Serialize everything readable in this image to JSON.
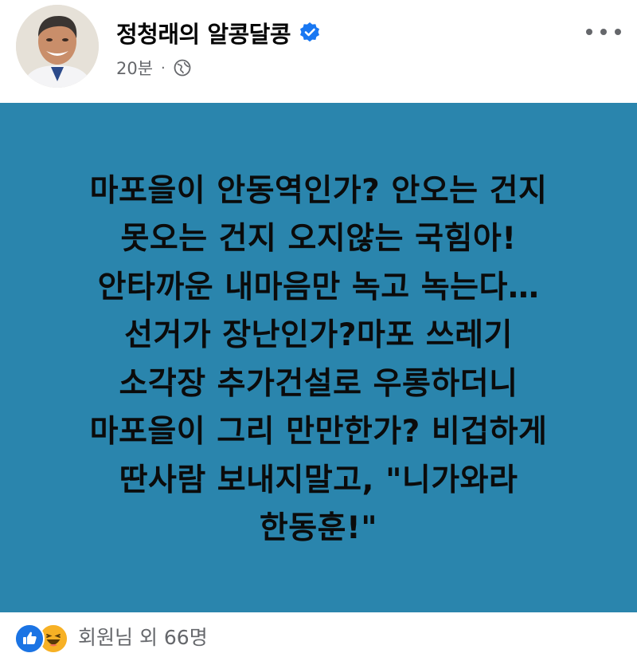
{
  "post": {
    "author": "정청래의 알콩달콩",
    "time": "20분",
    "separator": "·",
    "body_lines": [
      "마포을이 안동역인가? 안오는 건지",
      "못오는 건지 오지않는 국힘아!",
      "안타까운 내마음만 녹고 녹는다…",
      "선거가 장난인가?마포 쓰레기",
      "소각장 추가건설로 우롱하더니",
      "마포을이 그리 만만한가? 비겁하게",
      "딴사람 보내지말고, \"니가와라",
      "한동훈!\""
    ],
    "background_color": "#2a85ad",
    "icons": {
      "verified": "verified-badge-icon",
      "privacy": "globe-icon",
      "more": "more-options-icon",
      "reaction_1": "like-reaction-icon",
      "reaction_2": "haha-reaction-icon"
    }
  },
  "reactions": {
    "summary": "회원님 외 66명"
  }
}
